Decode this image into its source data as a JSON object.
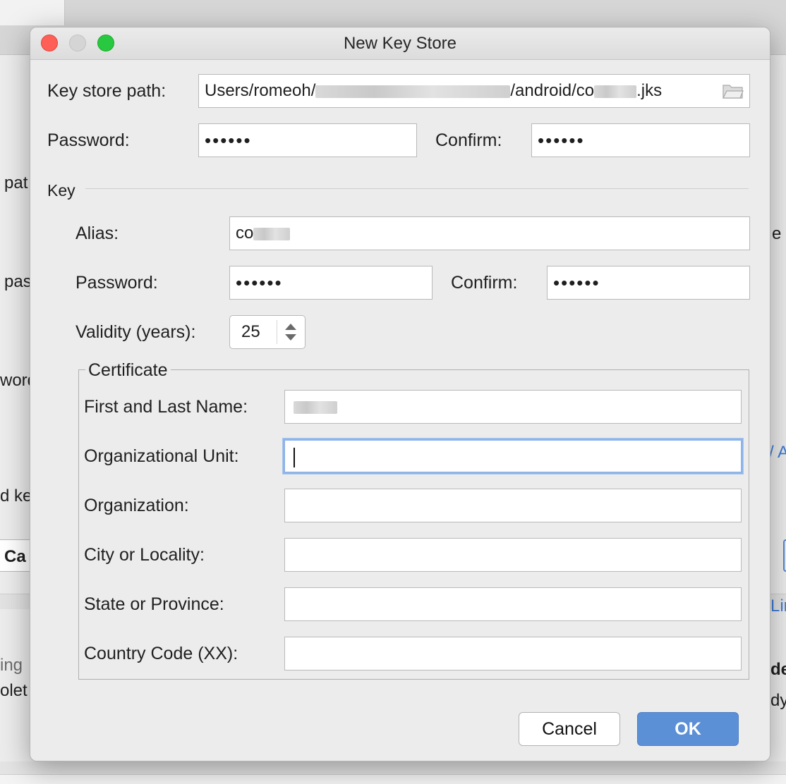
{
  "dialog": {
    "title": "New Key Store",
    "keystore": {
      "path_label": "Key store path:",
      "path_prefix": "Users/romeoh/",
      "path_middle": "/android/co",
      "path_suffix": ".jks",
      "password_label": "Password:",
      "password_value": "••••••",
      "confirm_label": "Confirm:",
      "confirm_value": "••••••"
    },
    "key": {
      "section_label": "Key",
      "alias_label": "Alias:",
      "alias_value": "co",
      "password_label": "Password:",
      "password_value": "••••••",
      "confirm_label": "Confirm:",
      "confirm_value": "••••••",
      "validity_label": "Validity (years):",
      "validity_value": "25"
    },
    "certificate": {
      "legend": "Certificate",
      "first_last_label": "First and Last Name:",
      "org_unit_label": "Organizational Unit:",
      "org_label": "Organization:",
      "city_label": "City or Locality:",
      "state_label": "State or Province:",
      "country_label": "Country Code (XX):"
    },
    "buttons": {
      "cancel": "Cancel",
      "ok": "OK"
    }
  },
  "background": {
    "frag_pat": "pat",
    "frag_pas": "pas",
    "frag_word": "word",
    "frag_dke": "d ke",
    "frag_ca": "Ca",
    "frag_ing": "ing",
    "frag_olet": "olet",
    "frag_e": "e",
    "frag_a": "/ A",
    "frag_lin": "Lin",
    "frag_de": "de",
    "frag_dy": "dy"
  },
  "colors": {
    "ok_button": "#5b8fd6",
    "focus_ring": "#8fb4e8",
    "close": "#fe5f57",
    "maximize": "#28c840"
  }
}
